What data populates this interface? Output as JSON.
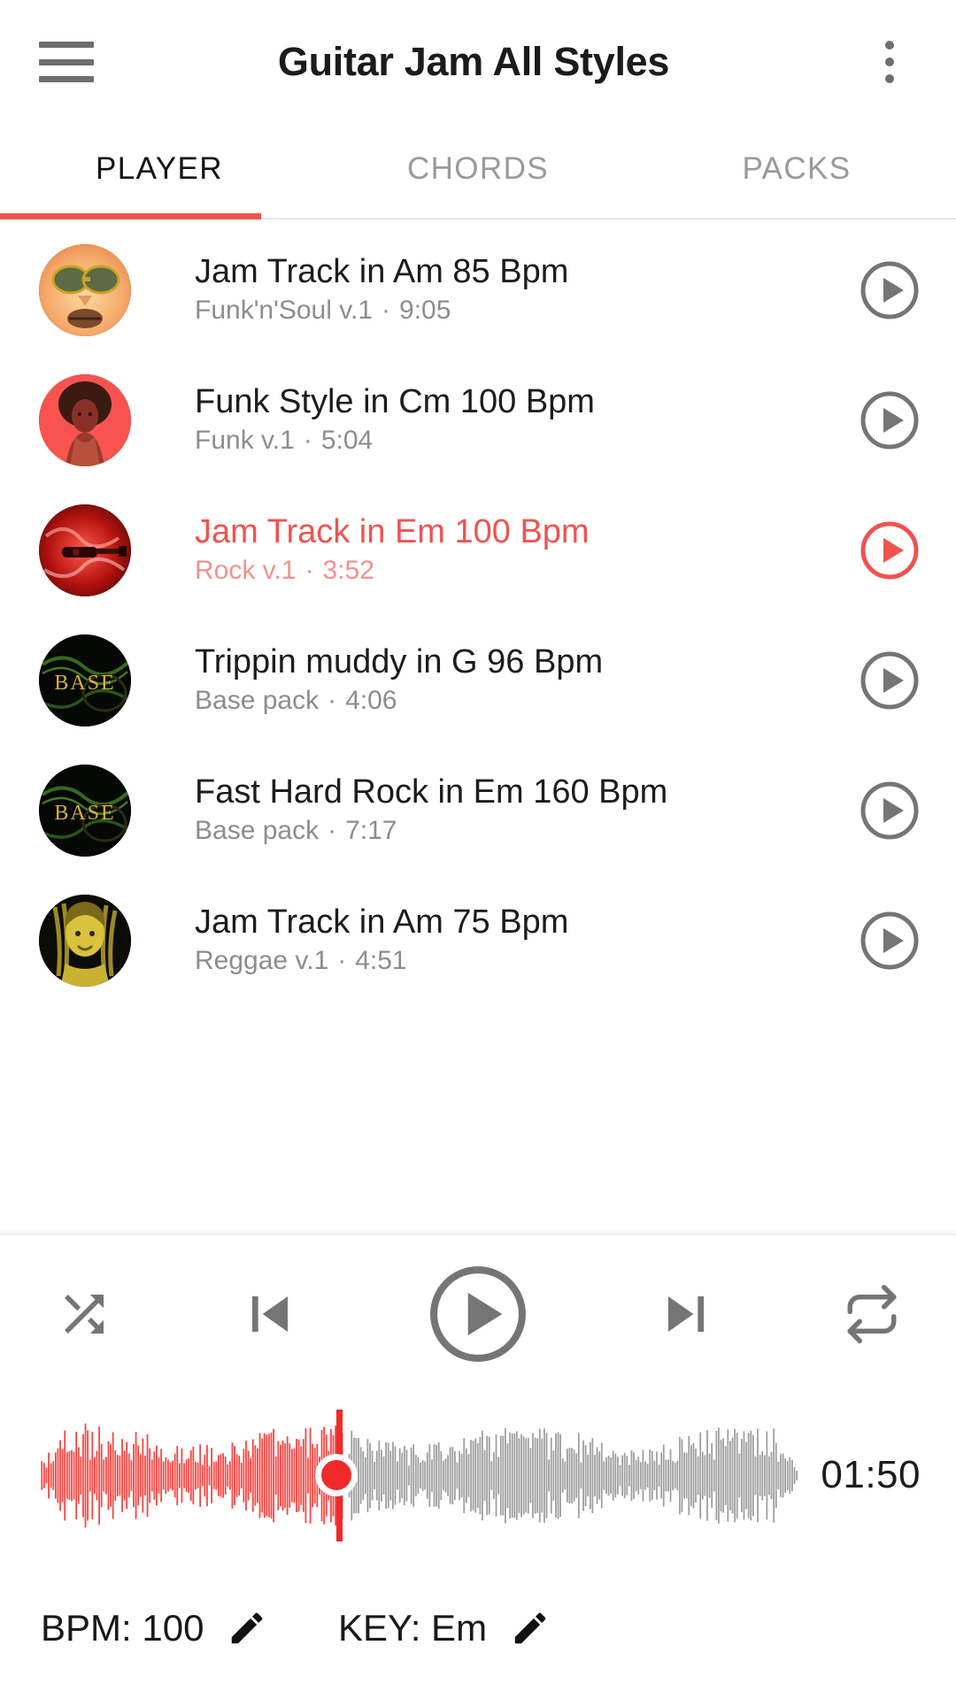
{
  "appbar": {
    "menu_icon": "hamburger-menu-icon",
    "title": "Guitar Jam All Styles",
    "overflow_icon": "more-vertical-icon"
  },
  "tabs": {
    "items": [
      {
        "label": "PLAYER",
        "active": true
      },
      {
        "label": "CHORDS",
        "active": false
      },
      {
        "label": "PACKS",
        "active": false
      }
    ],
    "indicator_color": "#ef5350"
  },
  "tracks": [
    {
      "title": "Jam Track in Am 85 Bpm",
      "pack": "Funk'n'Soul v.1",
      "separator": "·",
      "duration": "9:05",
      "active": false,
      "art": "face-sunglasses"
    },
    {
      "title": "Funk Style in Cm 100 Bpm",
      "pack": "Funk v.1",
      "separator": "·",
      "duration": "5:04",
      "active": false,
      "art": "afro-woman"
    },
    {
      "title": "Jam Track in Em 100 Bpm",
      "pack": "Rock v.1",
      "separator": "·",
      "duration": "3:52",
      "active": true,
      "art": "red-guitar-smoke"
    },
    {
      "title": "Trippin muddy in G 96 Bpm",
      "pack": "Base pack",
      "separator": "·",
      "duration": "4:06",
      "active": false,
      "art": "base-pack"
    },
    {
      "title": "Fast Hard Rock in Em 160 Bpm",
      "pack": "Base pack",
      "separator": "·",
      "duration": "7:17",
      "active": false,
      "art": "base-pack"
    },
    {
      "title": "Jam Track in Am 75 Bpm",
      "pack": "Reggae v.1",
      "separator": "·",
      "duration": "4:51",
      "active": false,
      "art": "reggae-dreads"
    }
  ],
  "player": {
    "controls": [
      {
        "name": "shuffle-button",
        "icon": "shuffle-icon"
      },
      {
        "name": "previous-button",
        "icon": "skip-previous-icon"
      },
      {
        "name": "play-button",
        "icon": "play-circle-icon"
      },
      {
        "name": "next-button",
        "icon": "skip-next-icon"
      },
      {
        "name": "repeat-button",
        "icon": "repeat-icon"
      }
    ],
    "waveform": {
      "elapsed_time": "01:50",
      "progress_percent": 39,
      "played_color": "#f9423f",
      "remaining_color": "#9e9e9e",
      "playhead_color": "#f02a2a"
    },
    "bpm_label": "BPM: 100",
    "key_label": "KEY: Em",
    "bpm_edit_icon": "pencil-icon",
    "key_edit_icon": "pencil-icon"
  },
  "colors": {
    "accent": "#ef5350",
    "icon_gray": "#6e6e6e",
    "text_primary": "#1c1c1c",
    "text_secondary": "#8d8d8d"
  }
}
